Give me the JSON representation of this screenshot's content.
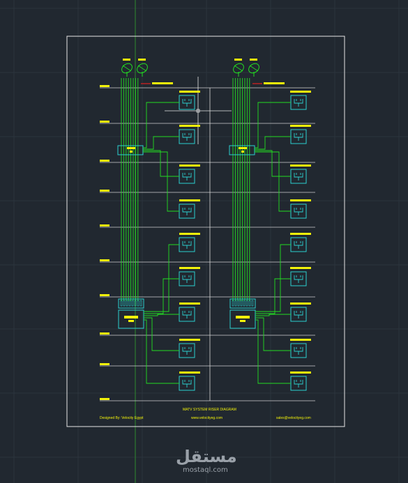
{
  "drawing": {
    "title": "MATV SYSTEM RISER DIAGRAM",
    "designer": "Designed By: Velocity Egypt",
    "website": "www.velocityeg.com",
    "email": "sales@velocityeg.com"
  },
  "watermark": {
    "arabic": "مستقل",
    "site": "mostaql.com"
  },
  "colors": {
    "background": "#212830",
    "grid": "#2c343d",
    "frame": "#e6e6e6",
    "riser": "#22dd22",
    "equipment": "#2cd0d0",
    "tags": "#f2f20a",
    "accent": "#e02020",
    "crosshair": "#2e8a2e"
  },
  "systems": [
    {
      "name": "left riser",
      "dishes": 2,
      "floors": 10,
      "outlets": 10
    },
    {
      "name": "right riser",
      "dishes": 2,
      "floors": 10,
      "outlets": 10
    }
  ]
}
